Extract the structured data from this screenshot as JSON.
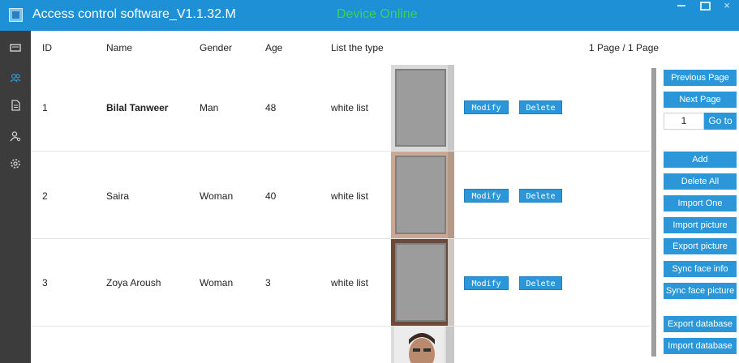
{
  "window": {
    "title": "Access control software_V1.1.32.M",
    "status": "Device Online",
    "status_color": "#39d35a",
    "controls": {
      "minimize": "minimize-icon",
      "maximize": "maximize-icon",
      "close": "×"
    }
  },
  "sidebar": {
    "icons": [
      "device-icon",
      "personnel-icon",
      "document-icon",
      "user-settings-icon",
      "settings-gear-icon"
    ]
  },
  "table": {
    "columns": [
      "ID",
      "Name",
      "Gender",
      "Age",
      "List the type"
    ],
    "page_info": "1 Page / 1 Page",
    "rows": [
      {
        "id": "1",
        "name": "Bilal Tanweer",
        "gender": "Man",
        "age": "48",
        "list_type": "white list",
        "modify": "Modify",
        "delete": "Delete"
      },
      {
        "id": "2",
        "name": "Saira",
        "gender": "Woman",
        "age": "40",
        "list_type": "white list",
        "modify": "Modify",
        "delete": "Delete"
      },
      {
        "id": "3",
        "name": "Zoya Aroush",
        "gender": "Woman",
        "age": "3",
        "list_type": "white list",
        "modify": "Modify",
        "delete": "Delete"
      },
      {
        "id": "",
        "name": "",
        "gender": "",
        "age": "",
        "list_type": "",
        "modify": "",
        "delete": ""
      }
    ]
  },
  "panel": {
    "previous_page": "Previous Page",
    "next_page": "Next Page",
    "page_input": "1",
    "goto": "Go to",
    "add": "Add",
    "delete_all": "Delete All",
    "import_one": "Import One",
    "import_picture": "Import picture",
    "export_picture": "Export picture",
    "sync_face_info": "Sync face info",
    "sync_face_picture": "Sync face picture",
    "export_database": "Export database",
    "import_database": "Import database"
  },
  "colors": {
    "titlebar": "#1e90d6",
    "sidebar": "#3c3c3c",
    "button": "#2b97d8"
  }
}
